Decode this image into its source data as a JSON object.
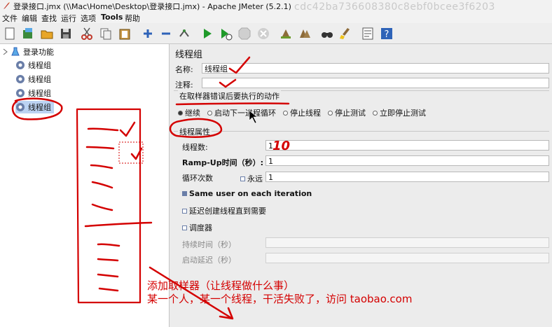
{
  "window": {
    "title": "登录接口.jmx (\\\\Mac\\Home\\Desktop\\登录接口.jmx) - Apache JMeter (5.2.1)",
    "watermark": "cdc42ba736608380c8ebf0bcee3f6203"
  },
  "menu": [
    "文件",
    "编辑",
    "查找",
    "运行",
    "选项",
    "Tools",
    "帮助"
  ],
  "toolbar": {
    "icons": [
      "new-icon",
      "templates-icon",
      "open-icon",
      "save-icon",
      "cut-icon",
      "copy-icon",
      "paste-icon",
      "expand-icon",
      "collapse-icon",
      "toggle-icon",
      "start-icon",
      "start-no-timers-icon",
      "stop-icon",
      "shutdown-icon",
      "clear-icon",
      "clear-all-icon",
      "search-icon",
      "reset-search-icon",
      "function-helper-icon",
      "help-icon"
    ]
  },
  "tree": {
    "root": "登录功能",
    "items": [
      "线程组",
      "线程组",
      "线程组",
      "线程组"
    ]
  },
  "panel": {
    "title": "线程组",
    "name_label": "名称:",
    "name_value": "线程组",
    "comment_label": "注释:",
    "comment_value": "",
    "error_section_label": "在取样器错误后要执行的动作",
    "error_actions": [
      "继续",
      "启动下一进程循环",
      "停止线程",
      "停止测试",
      "立即停止测试"
    ],
    "error_selected": "继续",
    "props_section_label": "线程属性",
    "threads_label": "线程数:",
    "threads_value": "1",
    "rampup_label": "Ramp-Up时间（秒）:",
    "rampup_value": "1",
    "loop_label": "循环次数",
    "forever_label": "永远",
    "loop_value": "1",
    "same_user_label": "Same user on each iteration",
    "delay_label": "延迟创建线程直到需要",
    "scheduler_label": "调度器",
    "duration_label": "持续时间（秒）",
    "startup_label": "启动延迟（秒）",
    "same_user_checked": true,
    "delay_checked": false,
    "scheduler_checked": false,
    "forever_checked": false
  },
  "annotation": {
    "line1": "添加取样器（让线程做什么事）",
    "line2": "某一个人，某一个线程，干活失败了，访问 taobao.com",
    "handwritten_count": "10",
    "ink_color": "#d40000"
  }
}
